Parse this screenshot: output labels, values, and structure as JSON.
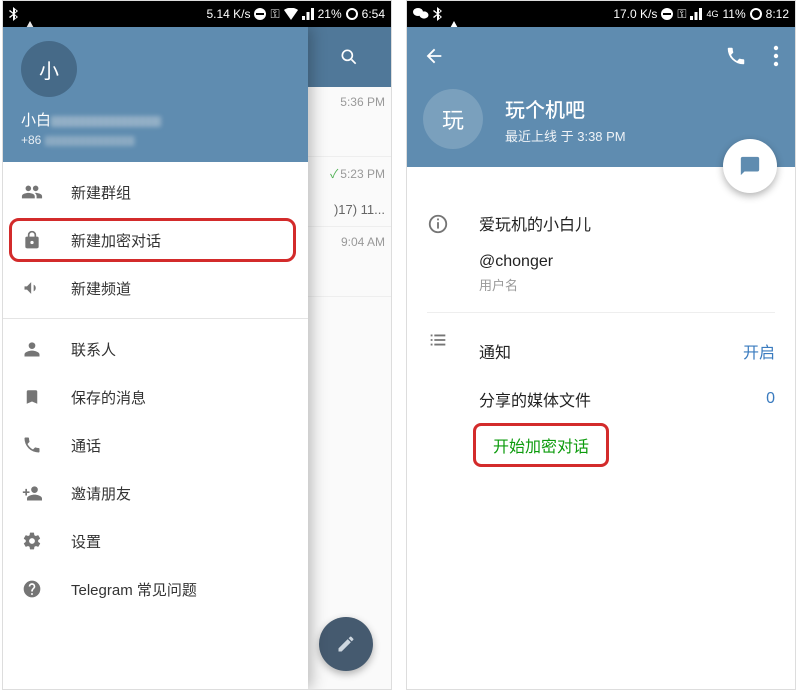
{
  "left": {
    "status": {
      "speed": "5.14 K/s",
      "battery": "21%",
      "time": "6:54"
    },
    "drawer": {
      "avatar_letter": "小",
      "name": "小白",
      "phone_prefix": "+86",
      "items": {
        "new_group": "新建群组",
        "new_secret_chat": "新建加密对话",
        "new_channel": "新建频道",
        "contacts": "联系人",
        "saved": "保存的消息",
        "calls": "通话",
        "invite": "邀请朋友",
        "settings": "设置",
        "faq": "Telegram 常见问题"
      }
    },
    "chats": {
      "t1": "5:36 PM",
      "t2": "5:23 PM",
      "t2_sub": ")17) 11...",
      "t3": "9:04 AM"
    }
  },
  "right": {
    "status": {
      "speed": "17.0 K/s",
      "net": "4G",
      "battery": "11%",
      "time": "8:12"
    },
    "profile": {
      "avatar_letter": "玩",
      "name": "玩个机吧",
      "last_seen": "最近上线 于 3:38 PM",
      "bio": "爱玩机的小白儿",
      "username": "@chonger",
      "username_label": "用户名",
      "notifications_label": "通知",
      "notifications_value": "开启",
      "shared_media_label": "分享的媒体文件",
      "shared_media_value": "0",
      "start_secret": "开始加密对话"
    }
  }
}
